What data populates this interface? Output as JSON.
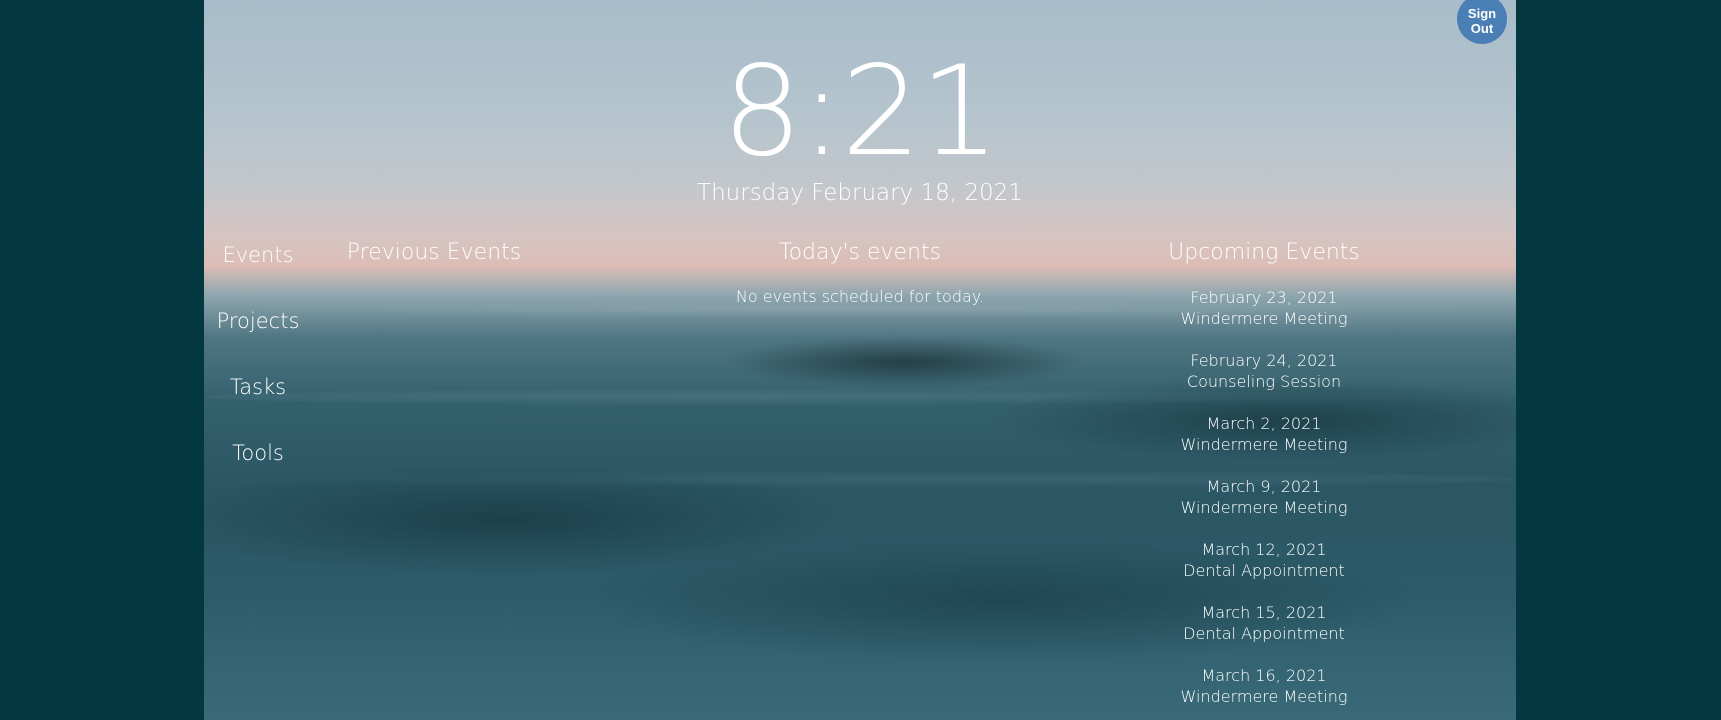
{
  "auth": {
    "sign_out_line1": "Sign",
    "sign_out_line2": "Out"
  },
  "clock": {
    "time": "8:21",
    "date": "Thursday February 18, 2021"
  },
  "nav": {
    "items": [
      {
        "label": "Events"
      },
      {
        "label": "Projects"
      },
      {
        "label": "Tasks"
      },
      {
        "label": "Tools"
      }
    ]
  },
  "events": {
    "previous_heading": "Previous Events",
    "today_heading": "Today's events",
    "today_empty": "No events scheduled for today.",
    "upcoming_heading": "Upcoming Events",
    "upcoming": [
      {
        "date": "February 23, 2021",
        "title": "Windermere Meeting"
      },
      {
        "date": "February 24, 2021",
        "title": "Counseling Session"
      },
      {
        "date": "March 2, 2021",
        "title": "Windermere Meeting"
      },
      {
        "date": "March 9, 2021",
        "title": "Windermere Meeting"
      },
      {
        "date": "March 12, 2021",
        "title": "Dental Appointment"
      },
      {
        "date": "March 15, 2021",
        "title": "Dental Appointment"
      },
      {
        "date": "March 16, 2021",
        "title": "Windermere Meeting"
      }
    ]
  },
  "colors": {
    "page_background": "#043840",
    "sign_out_button": "#4a7fb5",
    "text": "#ffffff"
  }
}
